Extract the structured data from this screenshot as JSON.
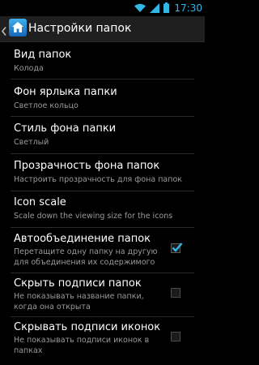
{
  "status_bar": {
    "time": "17:30",
    "icons": [
      "wifi-icon",
      "signal-icon",
      "battery-icon"
    ]
  },
  "action_bar": {
    "title": "Настройки папок",
    "icons": [
      "back-chevron-icon",
      "home-icon"
    ]
  },
  "preferences": [
    {
      "title": "Вид папок",
      "summary": [
        "Колода"
      ],
      "checkbox": null
    },
    {
      "title": "Фон ярлыка папки",
      "summary": [
        "Светлое кольцо"
      ],
      "checkbox": null
    },
    {
      "title": "Стиль фона папки",
      "summary": [
        "Светлый"
      ],
      "checkbox": null
    },
    {
      "title": "Прозрачность фона папок",
      "summary": [
        "Настроить прозрачность для фона папок"
      ],
      "checkbox": null
    },
    {
      "title": "Icon scale",
      "summary": [
        "Scale down the viewing size for the icons"
      ],
      "checkbox": null
    },
    {
      "title": "Автообъединение папок",
      "summary": [
        "Перетащите одну папку на другую",
        "для объединения их содержимого"
      ],
      "checkbox": true
    },
    {
      "title": "Скрыть подписи папок",
      "summary": [
        "Не показывать название папки,",
        "когда она открыта"
      ],
      "checkbox": false
    },
    {
      "title": "Скрывать подписи иконок",
      "summary": [
        "Не показывать подписи иконок в",
        "папках"
      ],
      "checkbox": false
    }
  ],
  "colors": {
    "accent": "#33b5e5",
    "background": "#000000",
    "action_bar": "#1f1f1f",
    "summary_text": "#9a9a9a"
  }
}
